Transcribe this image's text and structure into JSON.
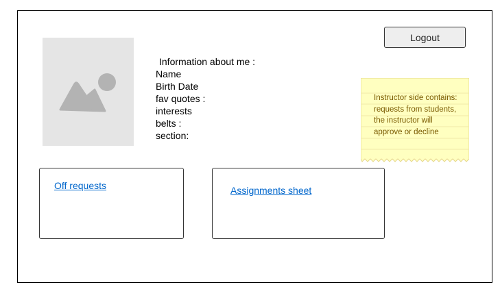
{
  "header": {
    "logout_label": "Logout"
  },
  "profile": {
    "heading": "Information about me :",
    "fields": [
      "Name",
      "Birth Date",
      "fav quotes :",
      "interests",
      "belts :",
      "section:"
    ]
  },
  "note": {
    "text": "Instructor side contains: requests from students, the instructor will approve or decline",
    "color": "#ffffc0"
  },
  "cards": {
    "off_requests_label": "Off requests",
    "assignments_label": "Assignments sheet"
  },
  "colors": {
    "link": "#0066cc",
    "placeholder": "#e5e5e5",
    "placeholder_icon": "#b3b3b3"
  }
}
